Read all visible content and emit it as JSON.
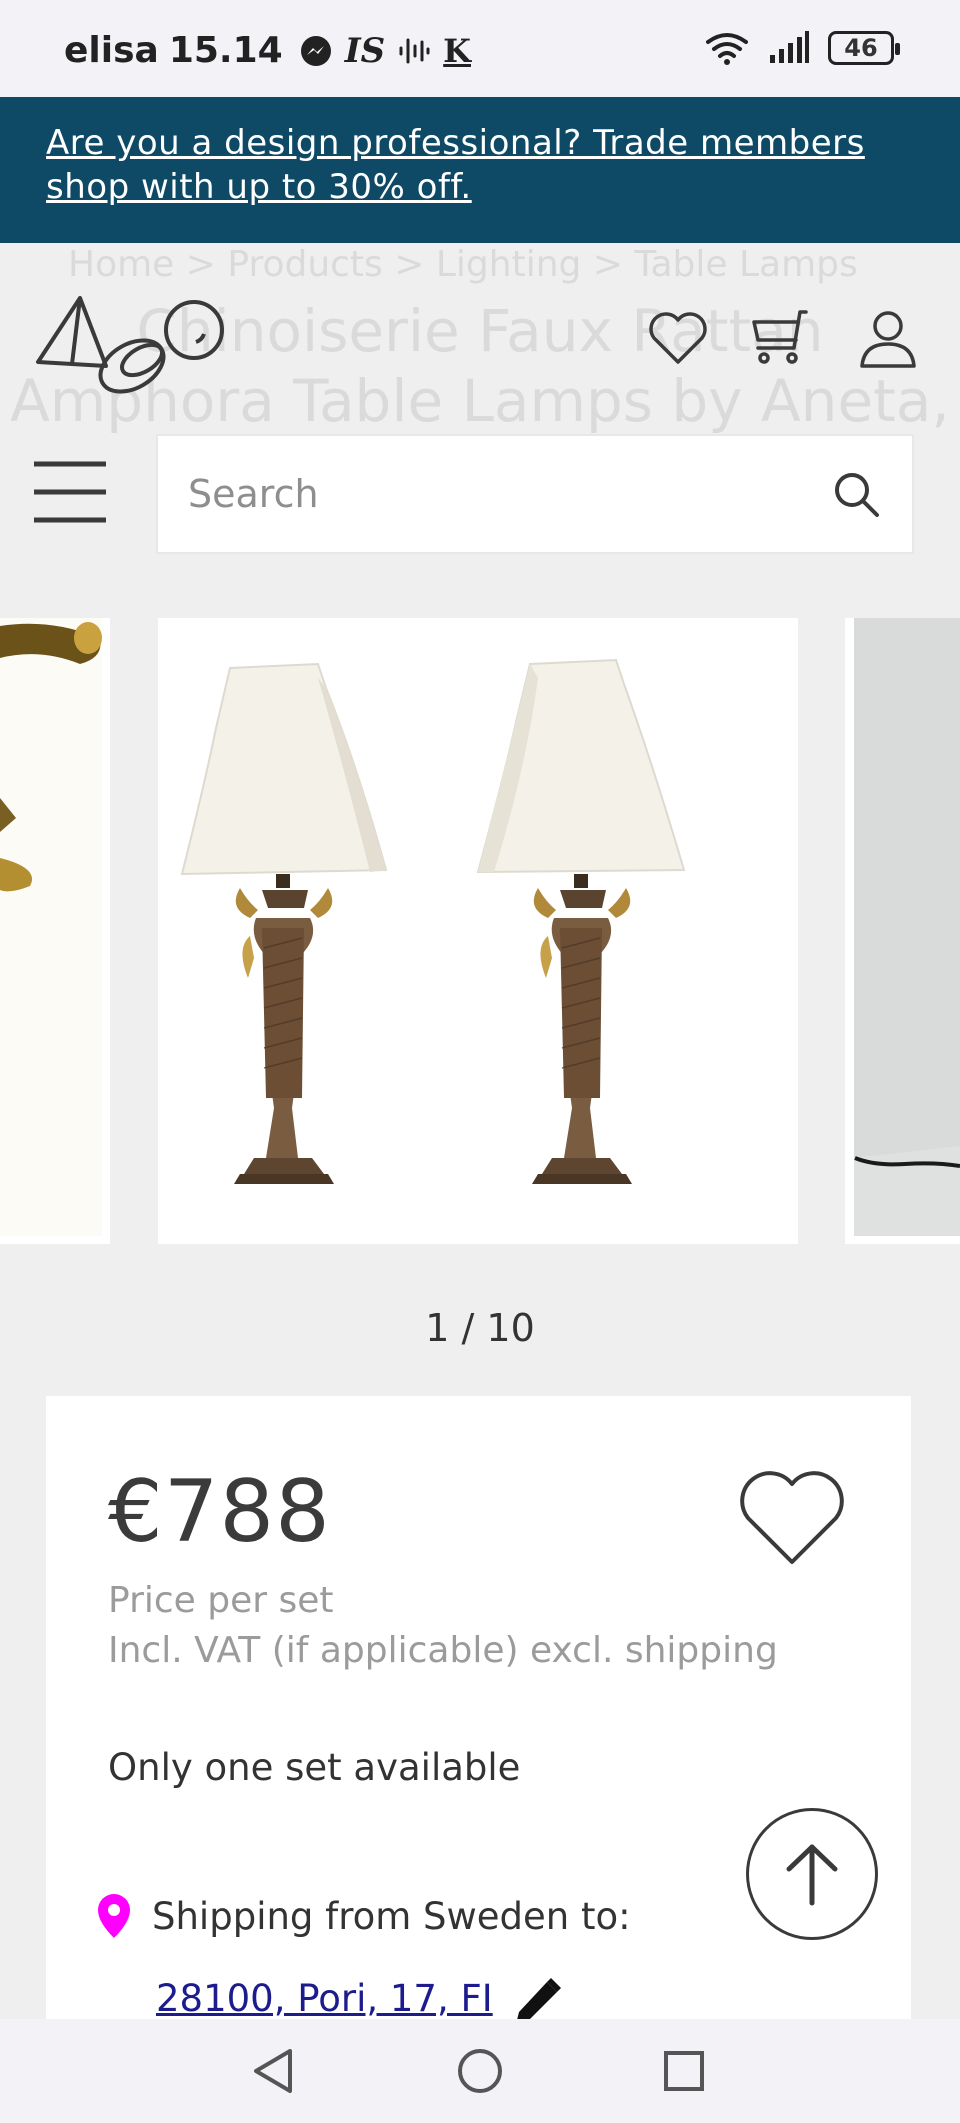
{
  "status_bar": {
    "carrier": "elisa",
    "time": "15.14",
    "app_badge_is": "IS",
    "app_badge_k": "K",
    "battery": "46"
  },
  "trade_banner": {
    "text": "Are you a design professional? Trade members shop with up to 30% off."
  },
  "breadcrumb": "Home > Products > Lighting > Table Lamps",
  "product_title_line1": "Chinoiserie Faux Rattan",
  "product_title_line2": "Amphora Table Lamps by Aneta,",
  "search": {
    "placeholder": "Search"
  },
  "carousel": {
    "current": "1 / 10"
  },
  "product": {
    "price": "€788",
    "price_unit": "Price per set",
    "vat_note": "Incl. VAT (if applicable) excl. shipping",
    "availability": "Only one set available",
    "shipping_label": "Shipping from Sweden to:",
    "shipping_destination": "28100, Pori, 17, FI"
  },
  "colors": {
    "banner_bg": "#0e4a66",
    "pin": "#ff00ff",
    "link": "#1c1c8f"
  }
}
